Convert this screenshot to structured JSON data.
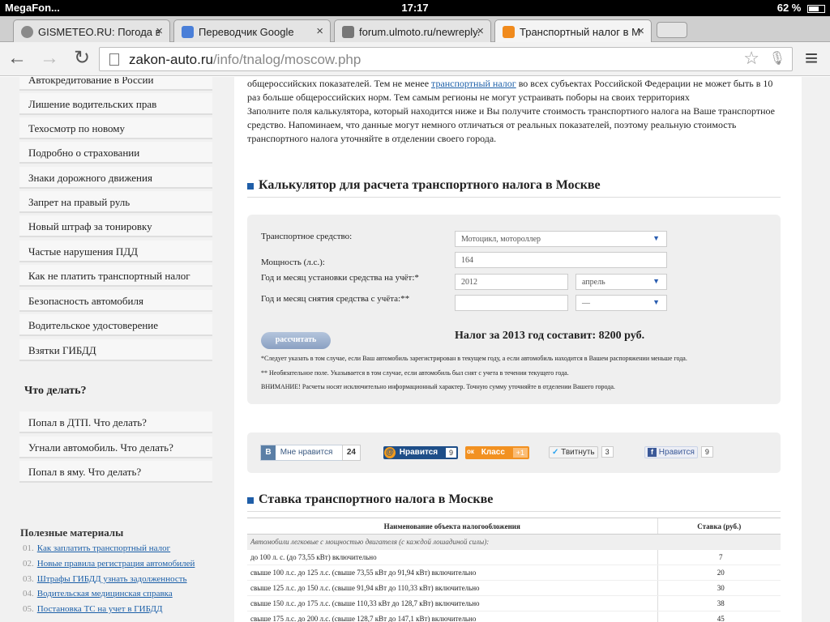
{
  "status_bar": {
    "carrier": "MegaFon...",
    "time": "17:17",
    "battery": "62 %"
  },
  "tabs": [
    {
      "title": "GISMETEO.RU: Погода в",
      "close": "×"
    },
    {
      "title": "Переводчик Google",
      "close": "×"
    },
    {
      "title": "forum.ulmoto.ru/newreply.p",
      "close": "×"
    },
    {
      "title": "Транспортный налог в Мо",
      "close": "×"
    }
  ],
  "toolbar": {
    "back": "←",
    "forward": "→",
    "reload": "↻",
    "star": "☆",
    "mic": "🎙",
    "menu": "≡"
  },
  "url": {
    "domain": "zakon-auto.ru",
    "path": "/info/tnalog/moscow.php"
  },
  "sidebar": {
    "items": [
      "Автокредитование в России",
      "Лишение водительских прав",
      "Техосмотр по новому",
      "Подробно о страховании",
      "Знаки дорожного движения",
      "Запрет на правый руль",
      "Новый штраф за тонировку",
      "Частые нарушения ПДД",
      "Как не платить транспортный налог",
      "Безопасность автомобиля",
      "Водительское удостоверение",
      "Взятки ГИБДД"
    ],
    "what_to_do_title": "Что делать?",
    "what_to_do": [
      "Попал в ДТП. Что делать?",
      "Угнали автомобиль. Что делать?",
      "Попал в яму. Что делать?"
    ],
    "useful_title": "Полезные материалы",
    "useful": [
      {
        "num": "01.",
        "label": "Как заплатить транспортный налог"
      },
      {
        "num": "02.",
        "label": "Новые правила регистрация автомобилей"
      },
      {
        "num": "03.",
        "label": "Штрафы ГИБДД узнать задолженность"
      },
      {
        "num": "04.",
        "label": "Водительская медицинская справка"
      },
      {
        "num": "05.",
        "label": "Постановка ТС на учет в ГИБДД"
      }
    ]
  },
  "intro": {
    "p1_before": "общероссийских показателей. Тем не менее ",
    "p1_link": "транспортный налог",
    "p1_after": " во всех субъектах Российской Федерации не может быть в 10 раз больше общероссийских норм. Тем самым регионы не могут устраивать поборы на своих территориях",
    "p2": "Заполните поля калькулятора, который находится ниже и Вы получите стоимость транспортного налога на Ваше транспортное средство. Напоминаем, что данные могут немного отличаться от реальных показателей, поэтому реальную стоимость транспортного налога уточняйте в отделении своего города."
  },
  "calculator": {
    "heading": "Калькулятор для расчета транспортного налога в Москве",
    "vehicle_label": "Транспортное средство:",
    "vehicle_value": "Мотоцикл, мотороллер",
    "power_label": "Мощность (л.с.):",
    "power_value": "164",
    "reg_label": "Год и месяц установки средства на учёт:*",
    "reg_year": "2012",
    "reg_month": "апрель",
    "dereg_label": "Год и месяц снятия средства с учёта:**",
    "dereg_year": "",
    "dereg_month": "—",
    "button": "рассчитать",
    "result": "Налог за 2013 год составит: 8200 руб.",
    "note1": "*Следует указать в том случае, если Ваш автомобиль зарегистрирован в текущем году, а если автомобиль находится в Вашем распоряжении меньше года.",
    "note2": "** Необязательное поле. Указывается в том случае, если автомобиль был снят с учета в течении текущего года.",
    "note3": "ВНИМАНИЕ! Расчеты носят исключительно информационный характер. Точную сумму уточняйте в отделении Вашего города."
  },
  "social": {
    "vk": {
      "icon": "В",
      "label": "Мне нравится",
      "count": "24"
    },
    "mailru": {
      "icon": "@",
      "label": "Нравится",
      "count": "9"
    },
    "ok": {
      "icon": "ок",
      "label": "Класс",
      "count": "+1"
    },
    "twitter": {
      "label": "Твитнуть",
      "count": "3"
    },
    "facebook": {
      "icon": "f",
      "label": "Нравится",
      "count": "9"
    }
  },
  "rates": {
    "heading": "Ставка транспортного налога в Москве",
    "col_object": "Наименование объекта налогообложения",
    "col_rate": "Ставка (руб.)",
    "category": "Автомобили легковые с мощностью двигателя (с каждой лошадиной силы):",
    "rows": [
      {
        "label": "до 100 л. с. (до 73,55 кВт) включительно",
        "rate": "7"
      },
      {
        "label": "свыше 100 л.с. до 125 л.с. (свыше 73,55 кВт до 91,94 кВт) включительно",
        "rate": "20"
      },
      {
        "label": "свыше 125 л.с. до 150 л.с. (свыше 91,94 кВт до 110,33 кВт) включительно",
        "rate": "30"
      },
      {
        "label": "свыше 150 л.с. до 175 л.с. (свыше 110,33 кВт до 128,7 кВт) включительно",
        "rate": "38"
      },
      {
        "label": "свыше 175 л.с. до 200 л.с. (свыше 128,7 кВт до 147,1 кВт) включительно",
        "rate": "45"
      }
    ]
  },
  "colors": {
    "accent": "#1f5ea8",
    "link": "#1b5fa8",
    "panel": "#efefef",
    "sidebar_bg": "#f1f1f1"
  }
}
